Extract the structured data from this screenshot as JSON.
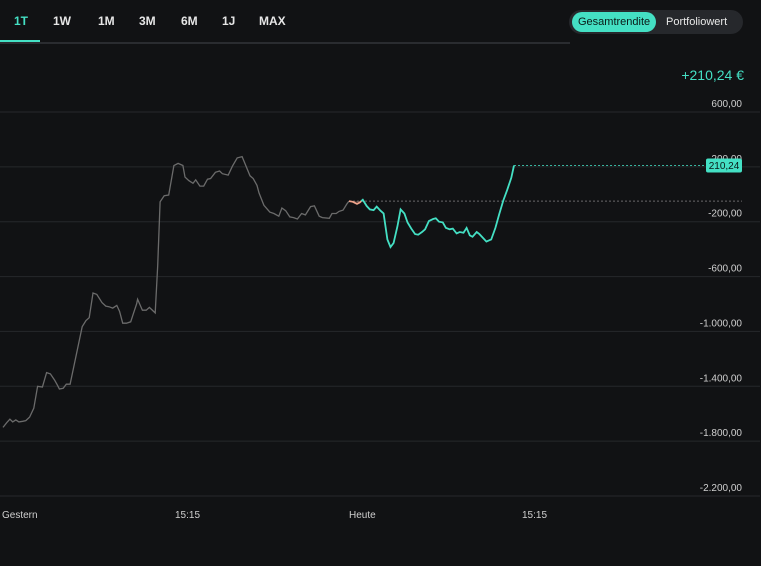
{
  "tabs": [
    {
      "label": "1T",
      "active": true
    },
    {
      "label": "1W",
      "active": false
    },
    {
      "label": "1M",
      "active": false
    },
    {
      "label": "3M",
      "active": false
    },
    {
      "label": "6M",
      "active": false
    },
    {
      "label": "1J",
      "active": false
    },
    {
      "label": "MAX",
      "active": false
    }
  ],
  "toggle": {
    "selected": "Gesamtrendite",
    "other": "Portfoliowert"
  },
  "return_label": "+210,24 €",
  "colors": {
    "accent": "#44e0c4",
    "line_gray": "#6b6b6b",
    "line_negative": "#f0a48c",
    "background": "#111214"
  },
  "chart_data": {
    "type": "line",
    "y_ticks": [
      {
        "value": 600,
        "label": "600,00"
      },
      {
        "value": 200,
        "label": "200,00"
      },
      {
        "value": -200,
        "label": "-200,00"
      },
      {
        "value": -600,
        "label": "-600,00"
      },
      {
        "value": -1000,
        "label": "-1.000,00"
      },
      {
        "value": -1400,
        "label": "-1.400,00"
      },
      {
        "value": -1800,
        "label": "-1.800,00"
      },
      {
        "value": -2200,
        "label": "-2.200,00"
      }
    ],
    "x_ticks": [
      {
        "value": 0,
        "label": "Gestern"
      },
      {
        "value": 0.5,
        "label": "15:15"
      },
      {
        "value": 1,
        "label": "Heute"
      },
      {
        "value": 1.5,
        "label": "15:15"
      }
    ],
    "ylim": [
      -2200,
      600
    ],
    "xlim": [
      0,
      2.13
    ],
    "baseline": -50,
    "current_value": 210.24,
    "current_label": "210,24",
    "previous_day": [
      [
        0.0,
        -1700
      ],
      [
        0.011,
        -1665
      ],
      [
        0.02,
        -1640
      ],
      [
        0.028,
        -1660
      ],
      [
        0.037,
        -1645
      ],
      [
        0.046,
        -1660
      ],
      [
        0.057,
        -1655
      ],
      [
        0.066,
        -1650
      ],
      [
        0.077,
        -1625
      ],
      [
        0.089,
        -1560
      ],
      [
        0.1,
        -1400
      ],
      [
        0.114,
        -1405
      ],
      [
        0.126,
        -1300
      ],
      [
        0.137,
        -1310
      ],
      [
        0.149,
        -1355
      ],
      [
        0.157,
        -1390
      ],
      [
        0.163,
        -1420
      ],
      [
        0.174,
        -1415
      ],
      [
        0.183,
        -1385
      ],
      [
        0.194,
        -1385
      ],
      [
        0.206,
        -1240
      ],
      [
        0.229,
        -965
      ],
      [
        0.24,
        -920
      ],
      [
        0.249,
        -900
      ],
      [
        0.26,
        -720
      ],
      [
        0.271,
        -730
      ],
      [
        0.286,
        -790
      ],
      [
        0.297,
        -815
      ],
      [
        0.306,
        -820
      ],
      [
        0.317,
        -830
      ],
      [
        0.329,
        -810
      ],
      [
        0.337,
        -855
      ],
      [
        0.346,
        -940
      ],
      [
        0.357,
        -940
      ],
      [
        0.369,
        -930
      ],
      [
        0.377,
        -870
      ],
      [
        0.386,
        -800
      ],
      [
        0.389,
        -765
      ],
      [
        0.403,
        -845
      ],
      [
        0.414,
        -845
      ],
      [
        0.423,
        -825
      ],
      [
        0.44,
        -865
      ],
      [
        0.447,
        -520
      ],
      [
        0.454,
        -55
      ],
      [
        0.466,
        -10
      ],
      [
        0.479,
        -5
      ],
      [
        0.494,
        210
      ],
      [
        0.506,
        225
      ],
      [
        0.52,
        210
      ],
      [
        0.526,
        125
      ],
      [
        0.537,
        100
      ],
      [
        0.549,
        80
      ],
      [
        0.557,
        105
      ],
      [
        0.569,
        60
      ],
      [
        0.58,
        60
      ],
      [
        0.591,
        110
      ],
      [
        0.6,
        115
      ],
      [
        0.614,
        160
      ],
      [
        0.626,
        170
      ],
      [
        0.634,
        150
      ],
      [
        0.651,
        140
      ],
      [
        0.663,
        205
      ],
      [
        0.677,
        265
      ],
      [
        0.691,
        275
      ],
      [
        0.7,
        220
      ],
      [
        0.714,
        135
      ],
      [
        0.723,
        115
      ],
      [
        0.734,
        65
      ],
      [
        0.74,
        10
      ],
      [
        0.754,
        -80
      ],
      [
        0.771,
        -130
      ],
      [
        0.783,
        -140
      ],
      [
        0.797,
        -160
      ],
      [
        0.806,
        -100
      ],
      [
        0.817,
        -120
      ],
      [
        0.829,
        -165
      ],
      [
        0.84,
        -170
      ],
      [
        0.851,
        -180
      ],
      [
        0.863,
        -140
      ],
      [
        0.874,
        -150
      ],
      [
        0.889,
        -90
      ],
      [
        0.9,
        -85
      ],
      [
        0.914,
        -160
      ],
      [
        0.923,
        -170
      ],
      [
        0.943,
        -175
      ],
      [
        0.951,
        -140
      ],
      [
        0.963,
        -140
      ],
      [
        0.971,
        -125
      ],
      [
        0.983,
        -115
      ],
      [
        0.994,
        -70
      ],
      [
        1.0,
        -50
      ]
    ],
    "today": [
      [
        1.0,
        -50
      ],
      [
        1.011,
        -55
      ],
      [
        1.023,
        -70
      ],
      [
        1.031,
        -60
      ],
      [
        1.04,
        -40
      ],
      [
        1.051,
        -85
      ],
      [
        1.06,
        -110
      ],
      [
        1.071,
        -115
      ],
      [
        1.08,
        -90
      ],
      [
        1.091,
        -120
      ],
      [
        1.1,
        -140
      ],
      [
        1.111,
        -330
      ],
      [
        1.12,
        -385
      ],
      [
        1.129,
        -355
      ],
      [
        1.14,
        -235
      ],
      [
        1.149,
        -110
      ],
      [
        1.16,
        -140
      ],
      [
        1.169,
        -205
      ],
      [
        1.18,
        -250
      ],
      [
        1.191,
        -290
      ],
      [
        1.2,
        -295
      ],
      [
        1.211,
        -275
      ],
      [
        1.22,
        -255
      ],
      [
        1.231,
        -195
      ],
      [
        1.243,
        -180
      ],
      [
        1.251,
        -175
      ],
      [
        1.26,
        -200
      ],
      [
        1.271,
        -205
      ],
      [
        1.28,
        -245
      ],
      [
        1.291,
        -255
      ],
      [
        1.3,
        -250
      ],
      [
        1.311,
        -285
      ],
      [
        1.32,
        -275
      ],
      [
        1.331,
        -280
      ],
      [
        1.34,
        -245
      ],
      [
        1.349,
        -300
      ],
      [
        1.357,
        -310
      ],
      [
        1.369,
        -275
      ],
      [
        1.377,
        -290
      ],
      [
        1.386,
        -315
      ],
      [
        1.397,
        -345
      ],
      [
        1.411,
        -330
      ],
      [
        1.423,
        -245
      ],
      [
        1.434,
        -145
      ],
      [
        1.446,
        -45
      ],
      [
        1.457,
        30
      ],
      [
        1.469,
        120
      ],
      [
        1.477,
        210.24
      ]
    ]
  }
}
